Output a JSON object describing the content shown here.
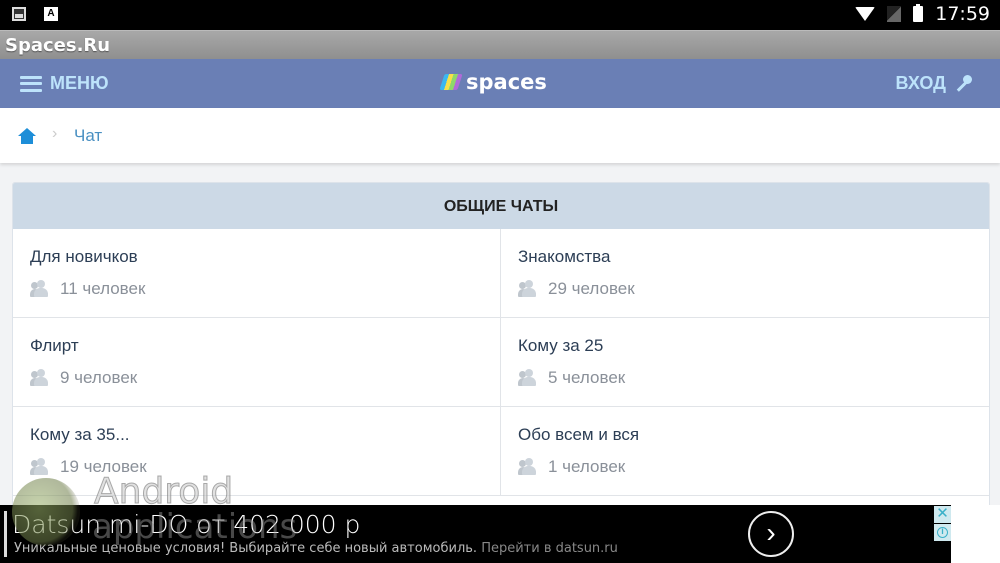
{
  "status_bar": {
    "time": "17:59",
    "left_icons": [
      "image-notification-icon",
      "text-notification-icon"
    ],
    "right_icons": [
      "wifi-icon",
      "no-sim-icon",
      "battery-charging-icon"
    ]
  },
  "window": {
    "title": "Spaces.Ru"
  },
  "navbar": {
    "menu_label": "МЕНЮ",
    "logo_text": "spaces",
    "login_label": "ВХОД",
    "bg_color": "#6a7fb5",
    "accent_color": "#bde3fb"
  },
  "breadcrumb": {
    "home_icon": "home-icon",
    "separator": "›",
    "current": "Чат"
  },
  "section": {
    "title": "ОБЩИЕ ЧАТЫ",
    "chats": [
      {
        "name": "Для новичков",
        "members": "11 человек"
      },
      {
        "name": "Знакомства",
        "members": "29 человек"
      },
      {
        "name": "Флирт",
        "members": "9 человек"
      },
      {
        "name": "Кому за 25",
        "members": "5 человек"
      },
      {
        "name": "Кому за 35...",
        "members": "19 человек"
      },
      {
        "name": "Обо всем и вся",
        "members": "1 человек"
      }
    ]
  },
  "watermark": {
    "line1": "Android",
    "line2": "applications"
  },
  "ad": {
    "title": "Datsun mi-DO от 402 000 р",
    "subtitle": "Уникальные ценовые условия! Выбирайте себе новый автомобиль.",
    "link_text": "Перейти в datsun.ru",
    "go_glyph": "›",
    "close_glyph": "✕"
  }
}
